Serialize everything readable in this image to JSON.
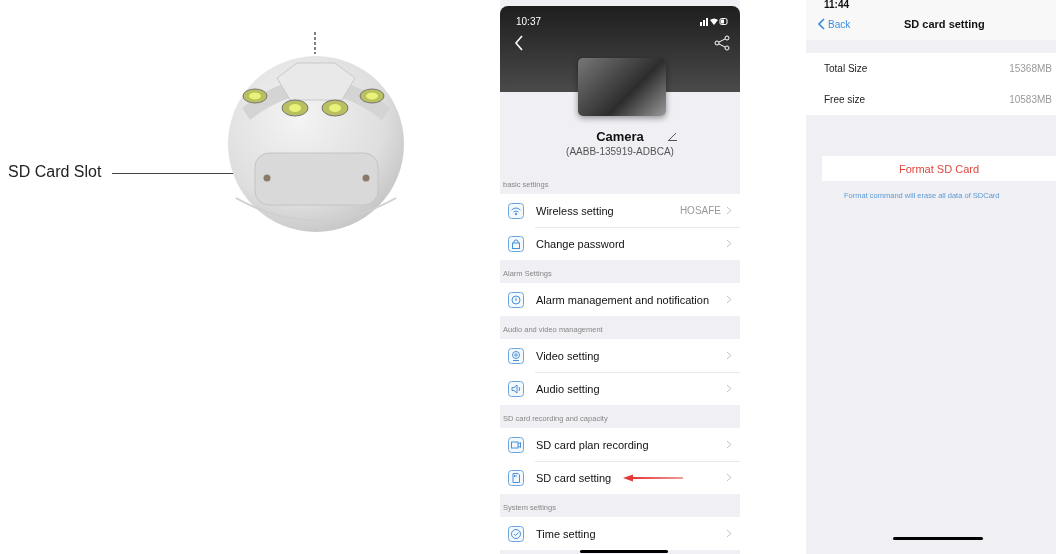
{
  "product_photo": {
    "callout": "SD Card Slot"
  },
  "camera_settings_screen": {
    "status_time": "10:37",
    "camera_name": "Camera",
    "camera_id": "(AABB-135919-ADBCA)",
    "sections": [
      {
        "title": "basic settings",
        "items": [
          {
            "kind": "wifi",
            "label": "Wireless setting",
            "value": "HOSAFE",
            "pointed": false
          },
          {
            "kind": "lock",
            "label": "Change password",
            "pointed": false
          }
        ]
      },
      {
        "title": "Alarm Settings",
        "items": [
          {
            "kind": "alarm",
            "label": "Alarm management and notification",
            "pointed": false
          }
        ]
      },
      {
        "title": "Audio and video management",
        "items": [
          {
            "kind": "video",
            "label": "Video setting",
            "pointed": false
          },
          {
            "kind": "audio",
            "label": "Audio setting",
            "pointed": false
          }
        ]
      },
      {
        "title": "SD card recording and capacity",
        "items": [
          {
            "kind": "record",
            "label": "SD card plan recording",
            "pointed": false
          },
          {
            "kind": "sdcard",
            "label": "SD card setting",
            "pointed": true
          }
        ]
      },
      {
        "title": "System settings",
        "items": [
          {
            "kind": "clock",
            "label": "Time setting",
            "pointed": false
          }
        ]
      }
    ]
  },
  "sd_card_screen": {
    "status_time": "11:44",
    "back": "Back",
    "title": "SD card setting",
    "rows": [
      {
        "label": "Total Size",
        "value": "15368MB"
      },
      {
        "label": "Free size",
        "value": "10583MB"
      }
    ],
    "format_button": "Format SD Card",
    "note": "Format command will erase all data of SDCard"
  }
}
